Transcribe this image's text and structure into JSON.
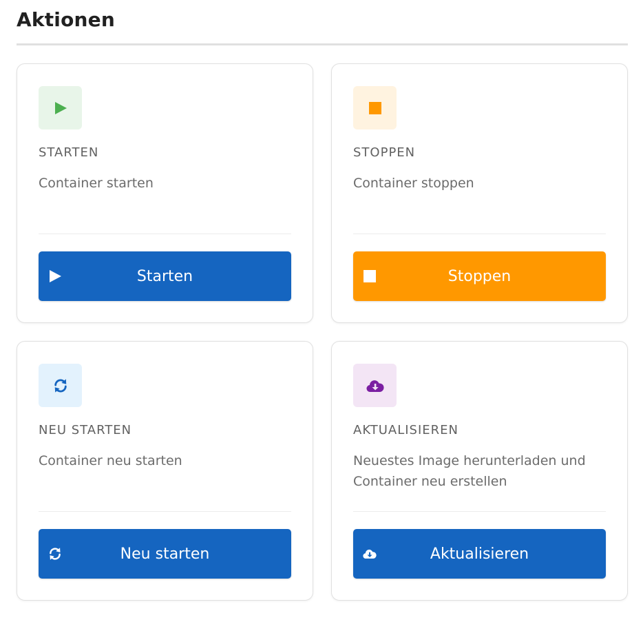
{
  "section": {
    "title": "Aktionen"
  },
  "cards": [
    {
      "icon": "play-icon",
      "title": "STARTEN",
      "description": "Container starten",
      "button_label": "Starten",
      "accent": "#4caf50",
      "button_color": "#1565c0"
    },
    {
      "icon": "stop-icon",
      "title": "STOPPEN",
      "description": "Container stoppen",
      "button_label": "Stoppen",
      "accent": "#ff9800",
      "button_color": "#ff9800"
    },
    {
      "icon": "refresh-icon",
      "title": "NEU STARTEN",
      "description": "Container neu starten",
      "button_label": "Neu starten",
      "accent": "#1565c0",
      "button_color": "#1565c0"
    },
    {
      "icon": "cloud-download-icon",
      "title": "AKTUALISIEREN",
      "description": "Neuestes Image herunterladen und Container neu erstellen",
      "button_label": "Aktualisieren",
      "accent": "#7b1fa2",
      "button_color": "#1565c0"
    }
  ]
}
